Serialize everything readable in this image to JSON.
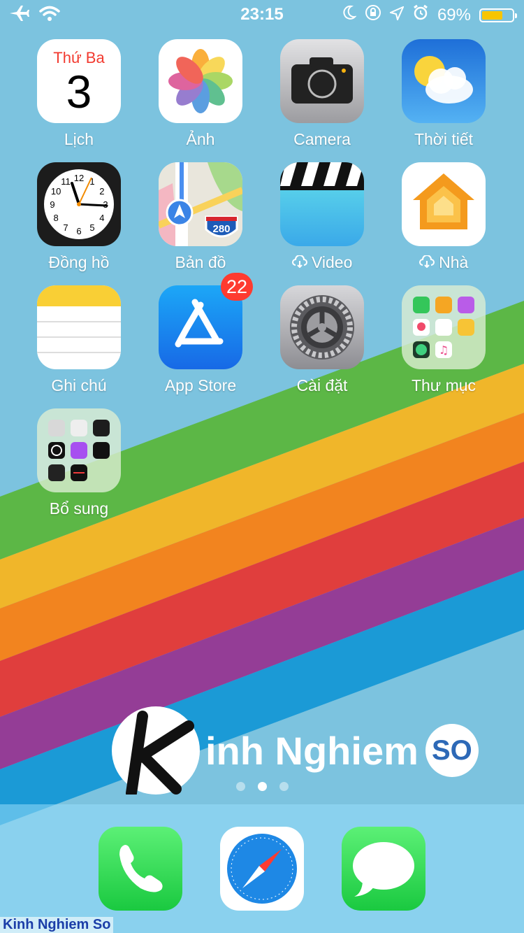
{
  "status_bar": {
    "time": "23:15",
    "battery_percent": "69%",
    "battery_level": 0.69,
    "icons": [
      "airplane-icon",
      "wifi-icon",
      "moon-icon",
      "rotation-lock-icon",
      "location-icon",
      "alarm-icon",
      "battery-icon"
    ]
  },
  "apps": [
    {
      "label": "Lịch",
      "icon": "calendar-icon",
      "weekday": "Thứ Ba",
      "day": "3"
    },
    {
      "label": "Ảnh",
      "icon": "photos-icon"
    },
    {
      "label": "Camera",
      "icon": "camera-icon"
    },
    {
      "label": "Thời tiết",
      "icon": "weather-icon"
    },
    {
      "label": "Đồng hồ",
      "icon": "clock-icon",
      "clock_numbers": [
        "12",
        "1",
        "2",
        "3",
        "4",
        "5",
        "6",
        "7",
        "8",
        "9",
        "10",
        "11"
      ]
    },
    {
      "label": "Bản đồ",
      "icon": "maps-icon",
      "shield": "280"
    },
    {
      "label": "Video",
      "icon": "videos-icon",
      "cloud_download": true
    },
    {
      "label": "Nhà",
      "icon": "home-icon",
      "cloud_download": true
    },
    {
      "label": "Ghi chú",
      "icon": "notes-icon"
    },
    {
      "label": "App Store",
      "icon": "app-store-icon",
      "badge": "22"
    },
    {
      "label": "Cài đặt",
      "icon": "settings-icon"
    },
    {
      "label": "Thư mục",
      "icon": "folder-icon"
    },
    {
      "label": "Bổ sung",
      "icon": "extras-folder-icon"
    }
  ],
  "page_indicator": {
    "pages": 3,
    "current": 2
  },
  "dock": [
    {
      "name": "phone",
      "icon": "phone-icon"
    },
    {
      "name": "safari",
      "icon": "safari-icon"
    },
    {
      "name": "messages",
      "icon": "messages-icon"
    }
  ],
  "watermark": {
    "main_text": "inh Nghiem",
    "badge_text": "SO",
    "footer_text": "Kinh Nghiem So"
  },
  "colors": {
    "badge": "#fe3b30",
    "battery": "#f7c500",
    "background": "#7cc3df"
  }
}
